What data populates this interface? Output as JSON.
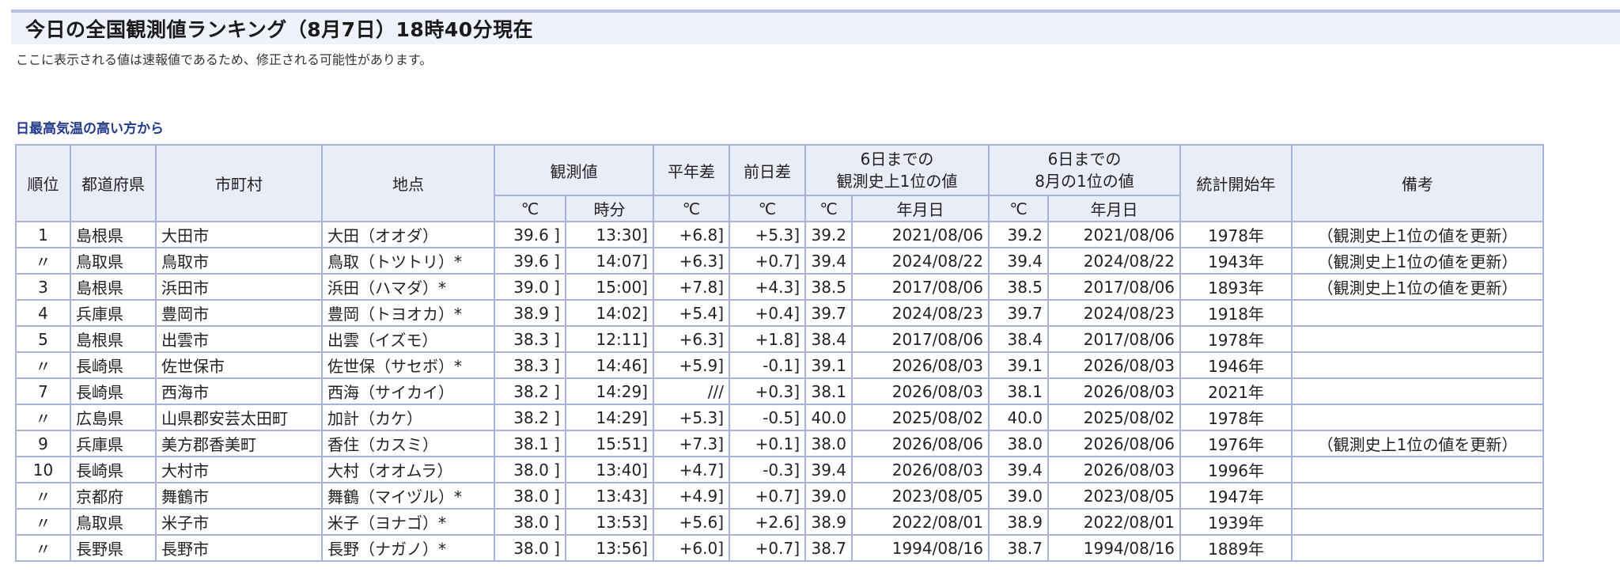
{
  "header": {
    "title": "今日の全国観測値ランキング（8月7日）18時40分現在",
    "disclaimer": "ここに表示される値は速報値であるため、修正される可能性があります。"
  },
  "section": {
    "title": "日最高気温の高い方から"
  },
  "table": {
    "headers": {
      "rank": "順位",
      "pref": "都道府県",
      "city": "市町村",
      "site": "地点",
      "obs": "観測値",
      "normal_diff": "平年差",
      "prev_diff": "前日差",
      "hist_record_line1": "6日までの",
      "hist_record_line2": "観測史上1位の値",
      "aug_record_line1": "6日までの",
      "aug_record_line2": "8月の1位の値",
      "start_year": "統計開始年",
      "note": "備考"
    },
    "subheaders": {
      "obs_c": "℃",
      "obs_time": "時分",
      "normal_c": "℃",
      "prev_c": "℃",
      "hist_c": "℃",
      "hist_date": "年月日",
      "aug_c": "℃",
      "aug_date": "年月日"
    },
    "rows": [
      {
        "rank": "1",
        "pref": "島根県",
        "city": "大田市",
        "site": "大田（オオダ）",
        "obs": "39.6 ]",
        "time": "13:30]",
        "normal": "+6.8]",
        "prev": "+5.3]",
        "hist_val": "39.2",
        "hist_date": "2021/08/06",
        "aug_val": "39.2",
        "aug_date": "2021/08/06",
        "start": "1978年",
        "note": "（観測史上1位の値を更新）"
      },
      {
        "rank": "〃",
        "pref": "鳥取県",
        "city": "鳥取市",
        "site": "鳥取（トツトリ）*",
        "obs": "39.6 ]",
        "time": "14:07]",
        "normal": "+6.3]",
        "prev": "+0.7]",
        "hist_val": "39.4",
        "hist_date": "2024/08/22",
        "aug_val": "39.4",
        "aug_date": "2024/08/22",
        "start": "1943年",
        "note": "（観測史上1位の値を更新）"
      },
      {
        "rank": "3",
        "pref": "島根県",
        "city": "浜田市",
        "site": "浜田（ハマダ）*",
        "obs": "39.0 ]",
        "time": "15:00]",
        "normal": "+7.8]",
        "prev": "+4.3]",
        "hist_val": "38.5",
        "hist_date": "2017/08/06",
        "aug_val": "38.5",
        "aug_date": "2017/08/06",
        "start": "1893年",
        "note": "（観測史上1位の値を更新）"
      },
      {
        "rank": "4",
        "pref": "兵庫県",
        "city": "豊岡市",
        "site": "豊岡（トヨオカ）*",
        "obs": "38.9 ]",
        "time": "14:02]",
        "normal": "+5.4]",
        "prev": "+0.4]",
        "hist_val": "39.7",
        "hist_date": "2024/08/23",
        "aug_val": "39.7",
        "aug_date": "2024/08/23",
        "start": "1918年",
        "note": ""
      },
      {
        "rank": "5",
        "pref": "島根県",
        "city": "出雲市",
        "site": "出雲（イズモ）",
        "obs": "38.3 ]",
        "time": "12:11]",
        "normal": "+6.3]",
        "prev": "+1.8]",
        "hist_val": "38.4",
        "hist_date": "2017/08/06",
        "aug_val": "38.4",
        "aug_date": "2017/08/06",
        "start": "1978年",
        "note": ""
      },
      {
        "rank": "〃",
        "pref": "長崎県",
        "city": "佐世保市",
        "site": "佐世保（サセボ）*",
        "obs": "38.3 ]",
        "time": "14:46]",
        "normal": "+5.9]",
        "prev": "-0.1]",
        "hist_val": "39.1",
        "hist_date": "2026/08/03",
        "aug_val": "39.1",
        "aug_date": "2026/08/03",
        "start": "1946年",
        "note": ""
      },
      {
        "rank": "7",
        "pref": "長崎県",
        "city": "西海市",
        "site": "西海（サイカイ）",
        "obs": "38.2 ]",
        "time": "14:29]",
        "normal": "///",
        "prev": "+0.3]",
        "hist_val": "38.1",
        "hist_date": "2026/08/03",
        "aug_val": "38.1",
        "aug_date": "2026/08/03",
        "start": "2021年",
        "note": ""
      },
      {
        "rank": "〃",
        "pref": "広島県",
        "city": "山県郡安芸太田町",
        "site": "加計（カケ）",
        "obs": "38.2 ]",
        "time": "14:29]",
        "normal": "+5.3]",
        "prev": "-0.5]",
        "hist_val": "40.0",
        "hist_date": "2025/08/02",
        "aug_val": "40.0",
        "aug_date": "2025/08/02",
        "start": "1978年",
        "note": ""
      },
      {
        "rank": "9",
        "pref": "兵庫県",
        "city": "美方郡香美町",
        "site": "香住（カスミ）",
        "obs": "38.1 ]",
        "time": "15:51]",
        "normal": "+7.3]",
        "prev": "+0.1]",
        "hist_val": "38.0",
        "hist_date": "2026/08/06",
        "aug_val": "38.0",
        "aug_date": "2026/08/06",
        "start": "1976年",
        "note": "（観測史上1位の値を更新）"
      },
      {
        "rank": "10",
        "pref": "長崎県",
        "city": "大村市",
        "site": "大村（オオムラ）",
        "obs": "38.0 ]",
        "time": "13:40]",
        "normal": "+4.7]",
        "prev": "-0.3]",
        "hist_val": "39.4",
        "hist_date": "2026/08/03",
        "aug_val": "39.4",
        "aug_date": "2026/08/03",
        "start": "1996年",
        "note": ""
      },
      {
        "rank": "〃",
        "pref": "京都府",
        "city": "舞鶴市",
        "site": "舞鶴（マイヅル）*",
        "obs": "38.0 ]",
        "time": "13:43]",
        "normal": "+4.9]",
        "prev": "+0.7]",
        "hist_val": "39.0",
        "hist_date": "2023/08/05",
        "aug_val": "39.0",
        "aug_date": "2023/08/05",
        "start": "1947年",
        "note": ""
      },
      {
        "rank": "〃",
        "pref": "鳥取県",
        "city": "米子市",
        "site": "米子（ヨナゴ）*",
        "obs": "38.0 ]",
        "time": "13:53]",
        "normal": "+5.6]",
        "prev": "+2.6]",
        "hist_val": "38.9",
        "hist_date": "2022/08/01",
        "aug_val": "38.9",
        "aug_date": "2022/08/01",
        "start": "1939年",
        "note": ""
      },
      {
        "rank": "〃",
        "pref": "長野県",
        "city": "長野市",
        "site": "長野（ナガノ）*",
        "obs": "38.0 ]",
        "time": "13:56]",
        "normal": "+6.0]",
        "prev": "+0.7]",
        "hist_val": "38.7",
        "hist_date": "1994/08/16",
        "aug_val": "38.7",
        "aug_date": "1994/08/16",
        "start": "1889年",
        "note": ""
      }
    ]
  }
}
